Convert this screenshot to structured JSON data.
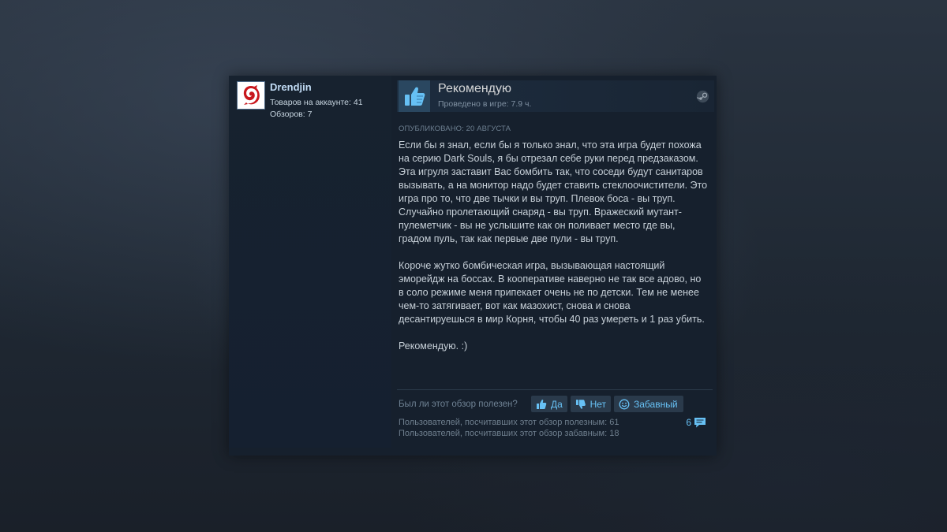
{
  "author": {
    "name": "Drendjin",
    "products_on_account": "Товаров на аккаунте: 41",
    "reviews_count": "Обзоров: 7"
  },
  "review": {
    "verdict": "Рекомендую",
    "playtime": "Проведено в игре: 7.9 ч.",
    "posted": "Опубликовано: 20 августа",
    "paragraphs": [
      "Если бы я знал, если бы я только знал, что эта игра будет похожа на серию Dark Souls, я бы отрезал себе руки перед предзаказом. Эта игруля заставит Вас бомбить так, что соседи будут санитаров вызывать, а на монитор надо будет ставить стеклоочистители. Это игра про то, что две тычки и вы труп. Плевок боса - вы труп. Случайно пролетающий снаряд - вы труп. Вражеский мутант-пулеметчик - вы не услышите как он поливает место где вы, градом пуль, так как первые две пули - вы труп.",
      "Короче жутко бомбическая игра, вызывающая настоящий эморейдж на боссах. В кооперативе наверно не так все адово, но в соло режиме меня припекает очень не по детски. Тем не менее чем-то затягивает, вот как мазохист, снова и снова десантируешься в мир Корня, чтобы 40 раз умереть и 1 раз убить.",
      "Рекомендую. :)"
    ]
  },
  "feedback": {
    "question": "Был ли этот обзор полезен?",
    "yes_label": "Да",
    "no_label": "Нет",
    "funny_label": "Забавный",
    "helpful_stats": "Пользователей, посчитавших этот обзор полезным: 61",
    "funny_stats": "Пользователей, посчитавших этот обзор забавным: 18",
    "comments_count": "6"
  },
  "colors": {
    "accent": "#67c1f5",
    "card_bg": "#16202d"
  },
  "icons": {
    "verdict": "thumbs-up-icon",
    "platform": "steam-icon",
    "comments": "speech-bubble-icon"
  }
}
